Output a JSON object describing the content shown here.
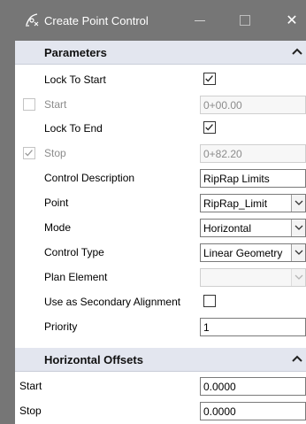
{
  "window": {
    "title": "Create Point Control",
    "minimize_glyph": "—",
    "close_glyph": "✕",
    "icon": "point-control-icon"
  },
  "parameters": {
    "header": "Parameters",
    "lock_to_start": {
      "label": "Lock To Start",
      "checked": true
    },
    "start": {
      "label": "Start",
      "value": "0+00.00",
      "enabled": false,
      "checked": false
    },
    "lock_to_end": {
      "label": "Lock To End",
      "checked": true
    },
    "stop": {
      "label": "Stop",
      "value": "0+82.20",
      "enabled": false,
      "checked": true
    },
    "control_description": {
      "label": "Control Description",
      "value": "RipRap Limits"
    },
    "point": {
      "label": "Point",
      "value": "RipRap_Limit"
    },
    "mode": {
      "label": "Mode",
      "value": "Horizontal"
    },
    "control_type": {
      "label": "Control Type",
      "value": "Linear Geometry"
    },
    "plan_element": {
      "label": "Plan Element",
      "value": ""
    },
    "use_secondary": {
      "label": "Use as Secondary Alignment",
      "checked": false
    },
    "priority": {
      "label": "Priority",
      "value": "1"
    }
  },
  "horizontal_offsets": {
    "header": "Horizontal Offsets",
    "start": {
      "label": "Start",
      "value": "0.0000"
    },
    "stop": {
      "label": "Stop",
      "value": "0.0000"
    }
  },
  "colors": {
    "titlebar": "#767676",
    "section_header": "#e3e6ef",
    "disabled_text": "#8c8c8c"
  }
}
